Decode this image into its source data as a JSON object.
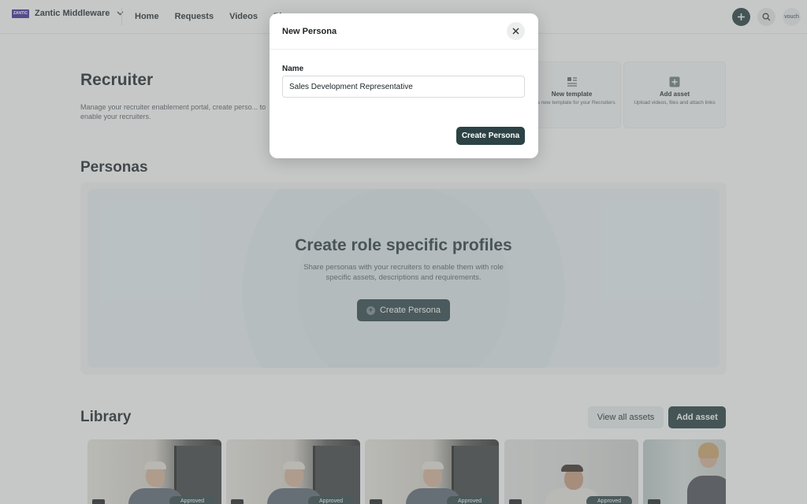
{
  "nav": {
    "brand_logo": "ZANTIC",
    "brand": "Zantic Middleware",
    "links": [
      "Home",
      "Requests",
      "Videos",
      "Pl"
    ],
    "avatar_label": "vouch"
  },
  "page": {
    "title": "Recruiter",
    "subtitle": "Manage your recruiter enablement portal, create perso... to enable your recruiters.",
    "cards": [
      {
        "title": "New template",
        "desc": "ate a new template for your Recruiters"
      },
      {
        "title": "Add asset",
        "desc": "Upload videos, files and attach links"
      }
    ]
  },
  "personas": {
    "title": "Personas",
    "empty_title": "Create role specific profiles",
    "empty_desc": "Share personas with your recruiters to enable them with role specific assets, descriptions and requirements.",
    "create_label": "Create Persona"
  },
  "library": {
    "title": "Library",
    "view_all_label": "View all assets",
    "add_label": "Add asset",
    "badge": "Approved"
  },
  "modal": {
    "title": "New Persona",
    "name_label": "Name",
    "name_value": "Sales Development Representative",
    "submit_label": "Create Persona"
  },
  "colors": {
    "accent": "#22393c",
    "overlay": "rgba(120,125,125,0.42)"
  }
}
